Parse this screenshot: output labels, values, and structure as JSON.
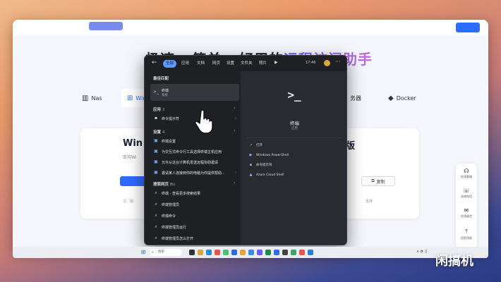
{
  "hero": {
    "plain": "极速 · 简单 · 好用的",
    "accent": "远程访问助手"
  },
  "os_tabs": [
    {
      "icon": "nas-icon",
      "glyph": "▥",
      "label": "Nas"
    },
    {
      "icon": "windows-icon",
      "glyph": "⊞",
      "label": "Windows"
    },
    {
      "icon": "server-icon",
      "glyph": "▤",
      "label": "务器"
    },
    {
      "icon": "docker-icon",
      "glyph": "◆",
      "label": "Docker"
    }
  ],
  "card": {
    "title": "Win",
    "title_right": "版",
    "line": "支持Wi",
    "copy_label": "复制",
    "foot": "注：如",
    "foot_right": "支持"
  },
  "float_bar": [
    {
      "icon": "headset-icon",
      "glyph": "☊",
      "label": "在线客服"
    },
    {
      "icon": "phone-icon",
      "glyph": "☏",
      "label": "咨询电话"
    },
    {
      "icon": "chat-icon",
      "glyph": "✉",
      "label": "在线留言"
    },
    {
      "icon": "top-icon",
      "glyph": "⤒",
      "label": "回到顶部"
    }
  ],
  "search": {
    "filters": [
      "全部",
      "应用",
      "文档",
      "网页",
      "设置",
      "文件夹",
      "照片"
    ],
    "time": "17:46",
    "best_match_label": "最佳匹配",
    "best_match": {
      "title": "终端",
      "sub": "系统"
    },
    "apps_label": "应用",
    "apps_count": "2",
    "apps": [
      {
        "title": "命令提示符"
      }
    ],
    "settings_label": "设置",
    "settings_count": "4",
    "settings": [
      "终端设置",
      "为交互式命令行工具选择终端主机应用",
      "允许从这台计算机发送远程协助邀请",
      "邀请某人连接到你的电脑为你提供帮助..."
    ],
    "web_label": "搜索网页",
    "web_count": "Bu",
    "web": [
      "终端 - 查看更多搜索结果",
      "终端管理员",
      "终端命令",
      "终端管理员运行",
      "终端管理员怎么打开"
    ],
    "preview": {
      "glyph": ">_",
      "title": "终端",
      "sub": "应用",
      "actions": [
        "打开",
        "Windows PowerShell",
        "命令提示符",
        "Azure Cloud Shell"
      ]
    }
  },
  "taskbar": {
    "search_placeholder": "搜索",
    "tray": "∧  ◔  ♫"
  },
  "watermark": "闲搞机"
}
